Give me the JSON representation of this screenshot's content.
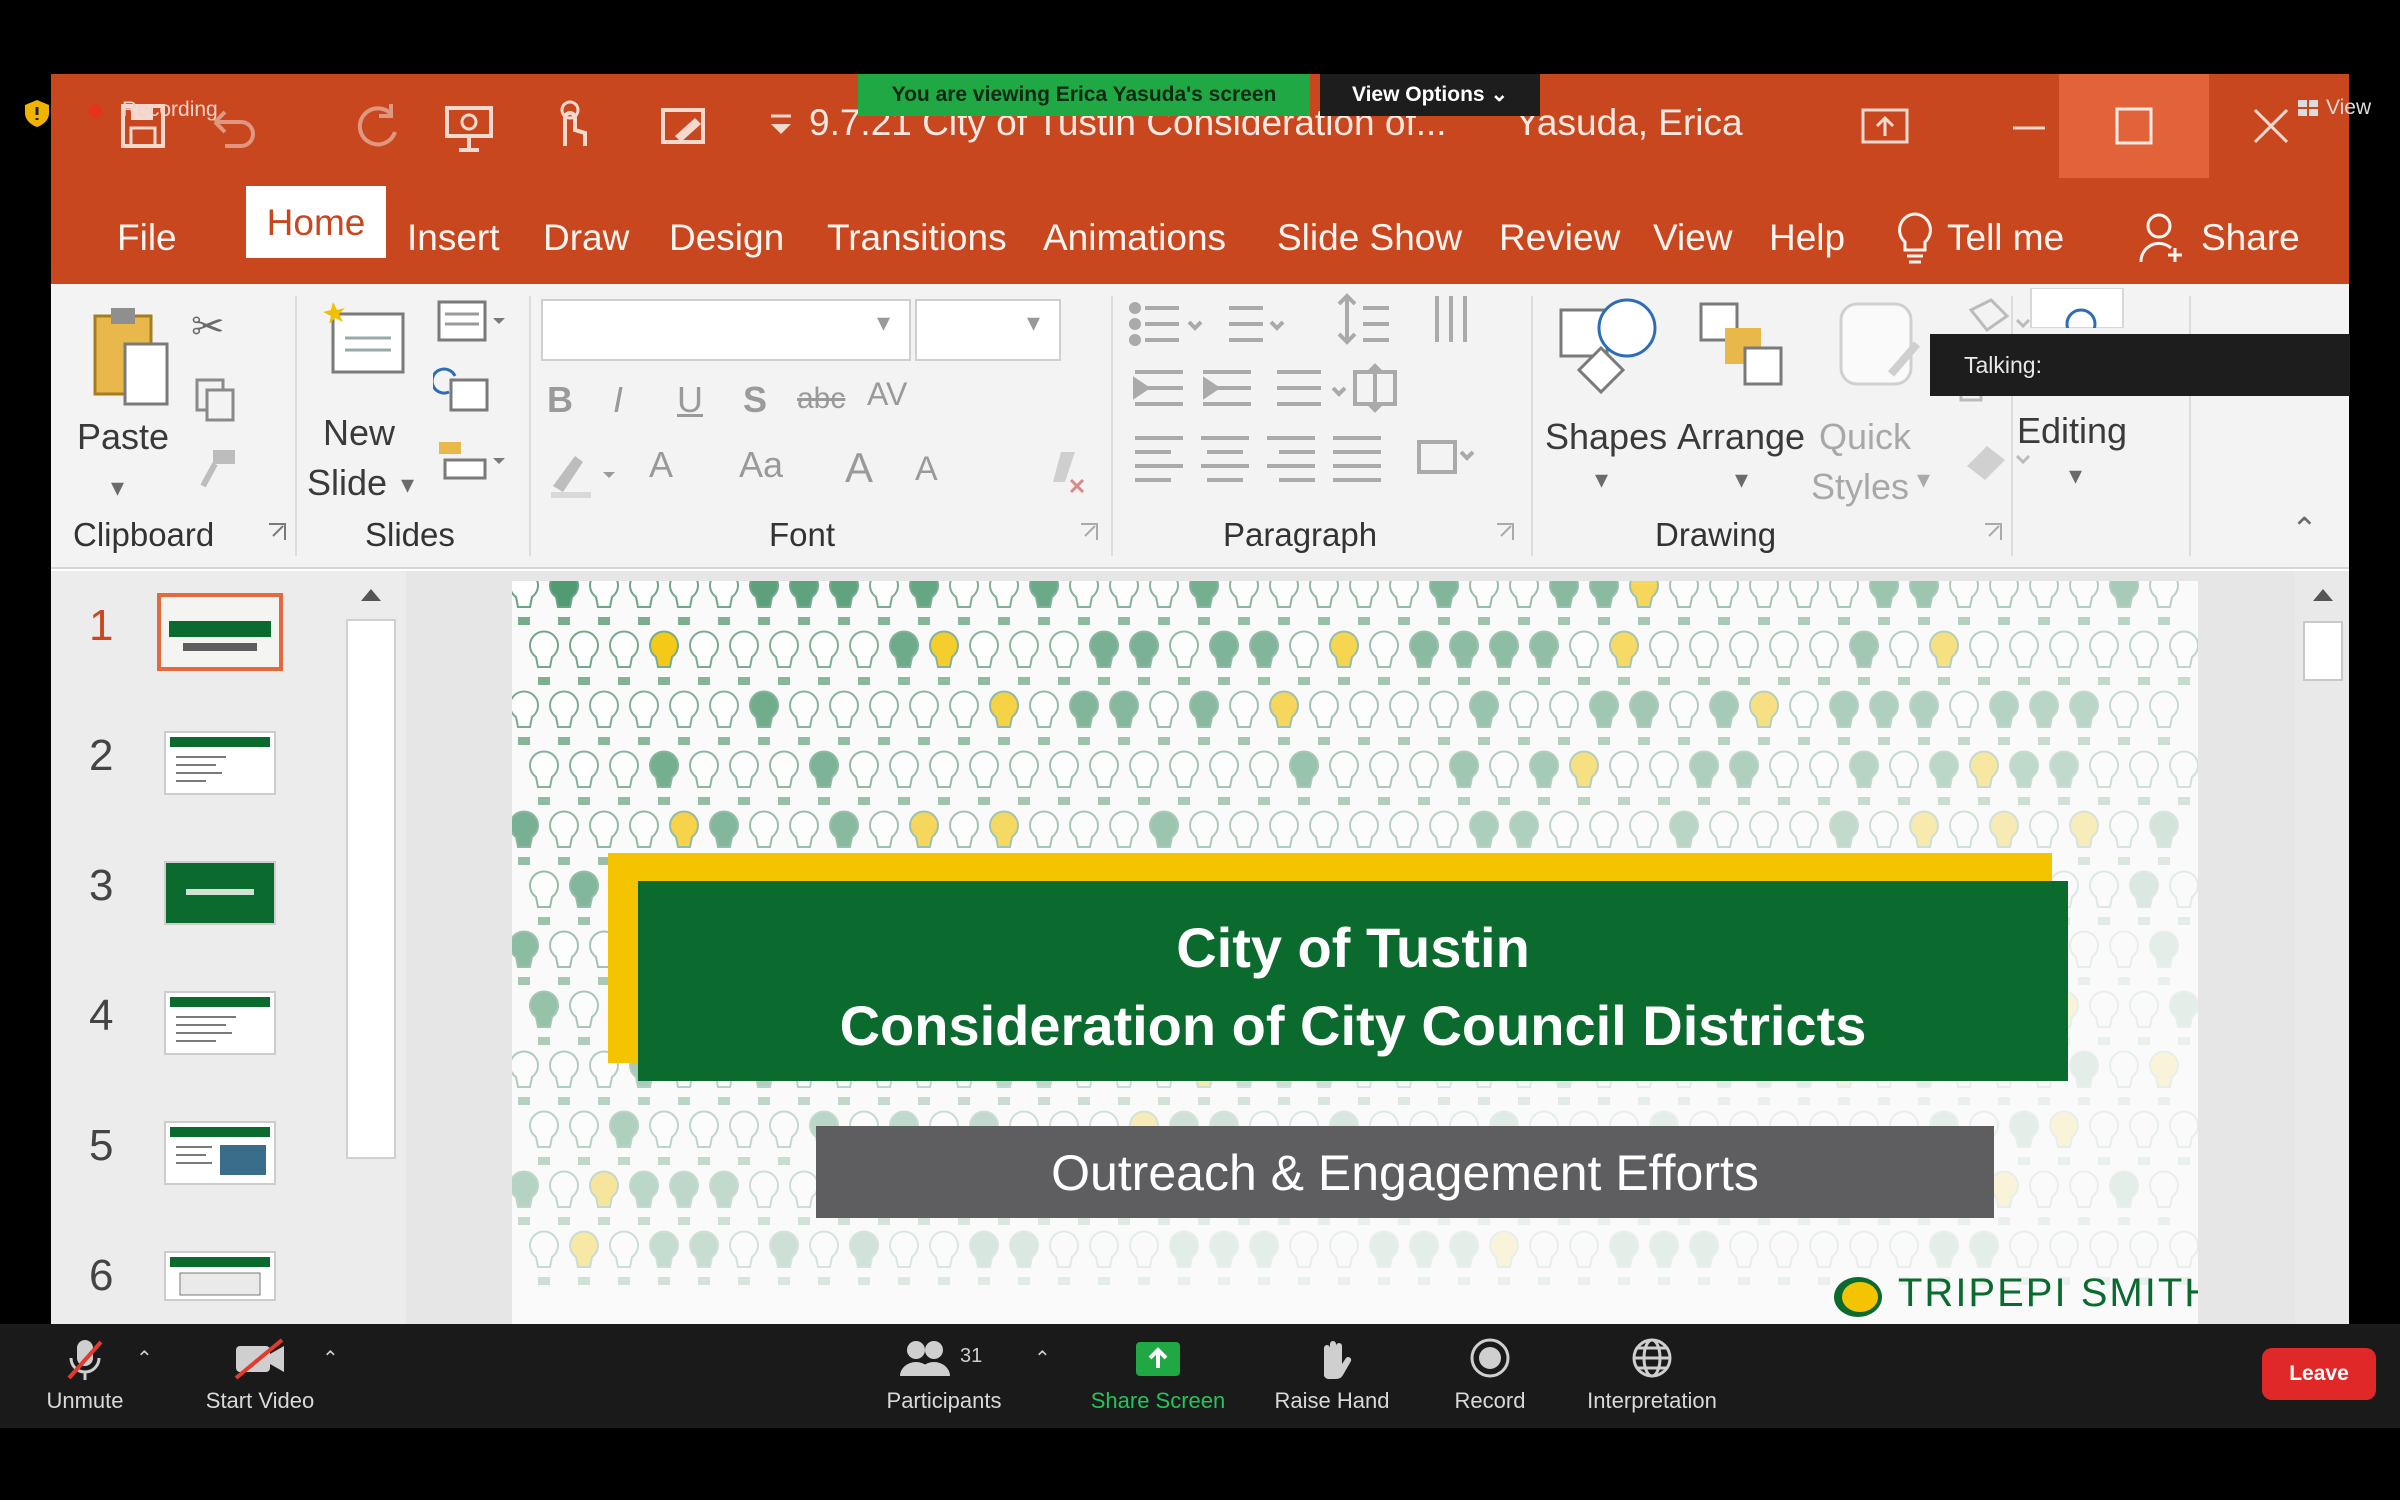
{
  "titlebar": {
    "document_title": "9.7.21 City of Tustin Consideration of...",
    "user": "Yasuda, Erica"
  },
  "ribbon_tabs": [
    "File",
    "Home",
    "Insert",
    "Draw",
    "Design",
    "Transitions",
    "Animations",
    "Slide Show",
    "Review",
    "View",
    "Help",
    "Tell me",
    "Share"
  ],
  "active_tab": "Home",
  "ribbon": {
    "paste": "Paste",
    "new_slide_line1": "New",
    "new_slide_line2": "Slide",
    "shapes": "Shapes",
    "arrange": "Arrange",
    "quick_styles_line1": "Quick",
    "quick_styles_line2": "Styles",
    "editing": "Editing",
    "font_buttons": {
      "bold": "B",
      "italic": "I",
      "underline": "U",
      "shadow": "S",
      "strike": "abc",
      "spacing": "AV",
      "font_color": "A",
      "change_case": "Aa",
      "grow": "A",
      "shrink": "A"
    },
    "groups": [
      "Clipboard",
      "Slides",
      "Font",
      "Paragraph",
      "Drawing"
    ]
  },
  "thumbnails": [
    "1",
    "2",
    "3",
    "4",
    "5",
    "6"
  ],
  "selected_thumbnail": "1",
  "slide": {
    "title_line1": "City of Tustin",
    "title_line2": "Consideration of City Council Districts",
    "subtitle": "Outreach & Engagement Efforts",
    "brand": "TRIPEPI SMITH"
  },
  "zoom": {
    "viewing_banner": "You are viewing Erica Yasuda's screen",
    "view_options": "View Options",
    "talking": "Talking:",
    "recording": "Recording",
    "view": "View",
    "toolbar": {
      "unmute": "Unmute",
      "start_video": "Start Video",
      "participants": "Participants",
      "participants_count": "31",
      "share_screen": "Share Screen",
      "raise_hand": "Raise Hand",
      "record": "Record",
      "interpretation": "Interpretation",
      "leave": "Leave"
    }
  },
  "colors": {
    "ppt_orange": "#c9471f",
    "slide_green": "#0b6b2e",
    "slide_yellow": "#f5c400",
    "subtitle_grey": "#5e5e60",
    "zoom_green": "#1fa844",
    "leave_red": "#e02828"
  }
}
